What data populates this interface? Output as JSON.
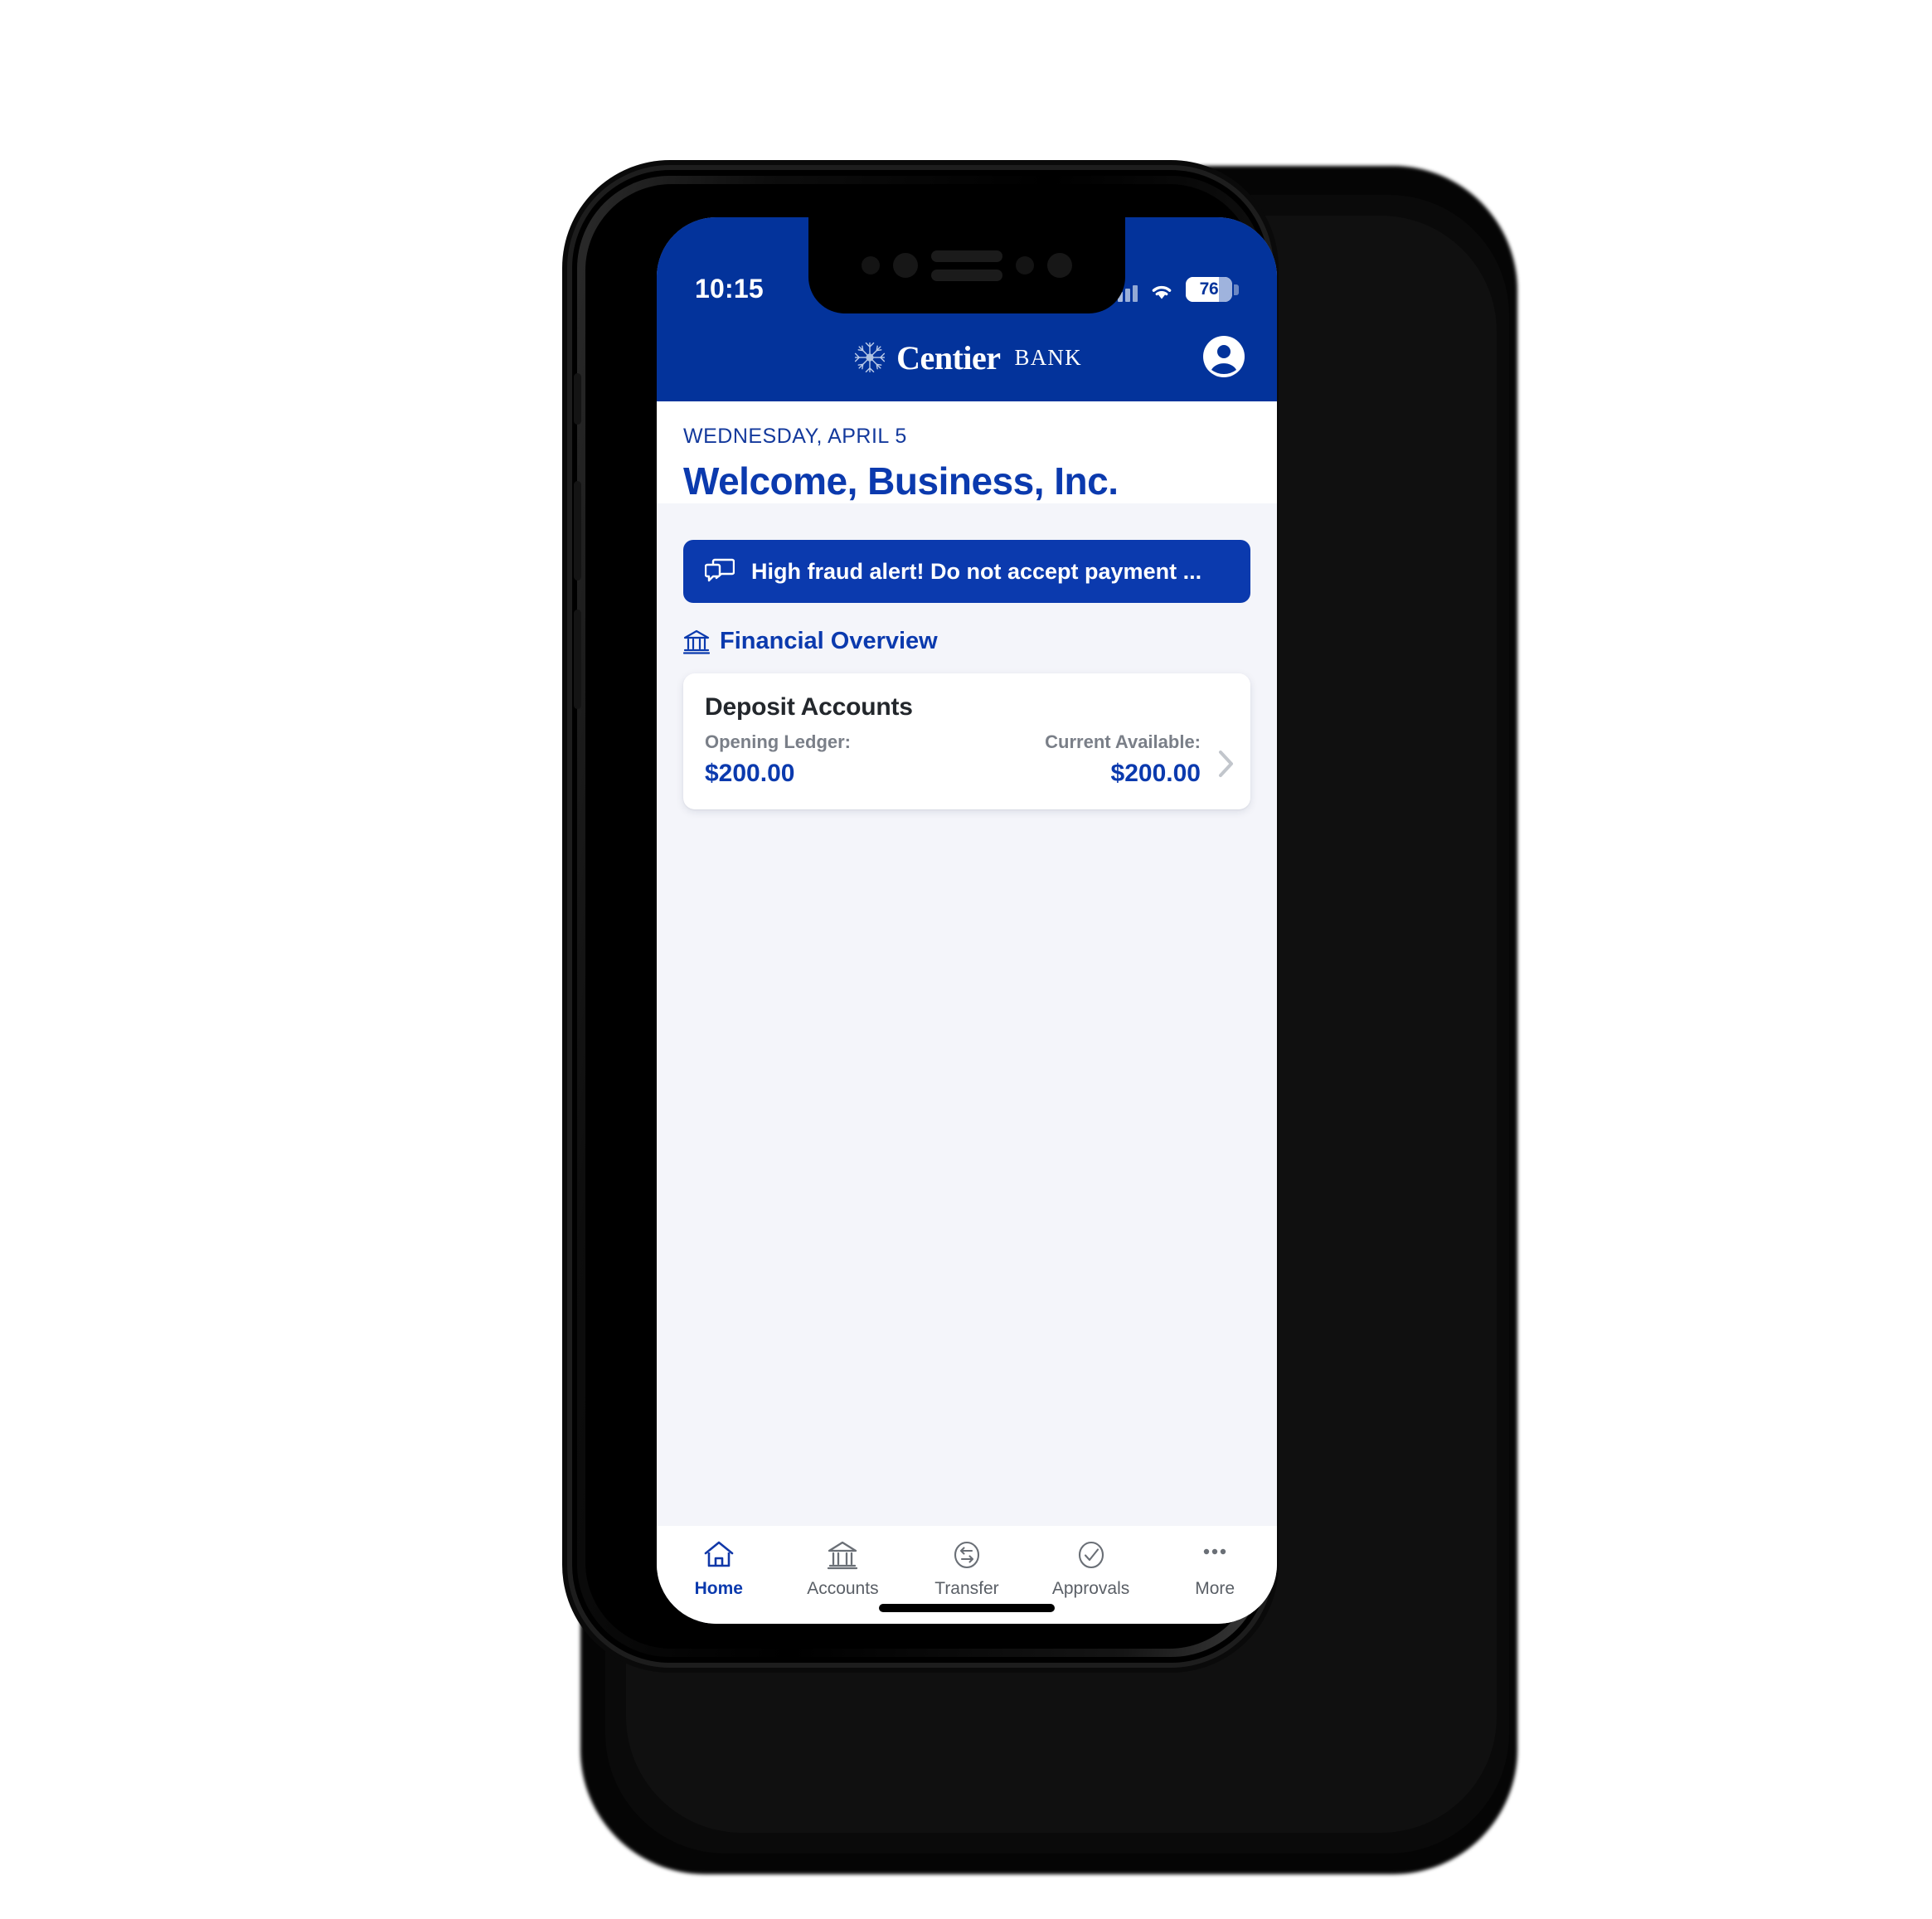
{
  "colors": {
    "brand_blue": "#03339B",
    "accent_blue": "#0B3AAE",
    "page_bg": "#F4F5FA",
    "card_bg": "#FFFFFF",
    "muted_text": "#7A7F88",
    "dark_text": "#23272C"
  },
  "status_bar": {
    "time": "10:15",
    "signal_icon": "cellular-signal-icon",
    "wifi_icon": "wifi-icon",
    "battery_level": "76",
    "battery_icon": "battery-icon"
  },
  "header": {
    "logo_mark": "snowflake-icon",
    "brand_name": "Centier",
    "brand_suffix": "BANK",
    "avatar_icon": "account-avatar-icon"
  },
  "greeting": {
    "date": "WEDNESDAY, APRIL 5",
    "welcome": "Welcome, Business, Inc."
  },
  "alert": {
    "icon": "message-bubbles-icon",
    "text": "High fraud alert! Do not accept payment ..."
  },
  "financial_overview": {
    "icon": "bank-building-icon",
    "title": "Financial Overview",
    "cards": [
      {
        "title": "Deposit Accounts",
        "left_label": "Opening Ledger:",
        "left_value": "$200.00",
        "right_label": "Current Available:",
        "right_value": "$200.00",
        "chevron_icon": "chevron-right-icon"
      }
    ]
  },
  "tabbar": {
    "items": [
      {
        "label": "Home",
        "icon": "home-icon",
        "active": true
      },
      {
        "label": "Accounts",
        "icon": "bank-icon",
        "active": false
      },
      {
        "label": "Transfer",
        "icon": "transfer-icon",
        "active": false
      },
      {
        "label": "Approvals",
        "icon": "check-circle-icon",
        "active": false
      },
      {
        "label": "More",
        "icon": "ellipsis-icon",
        "active": false
      }
    ]
  }
}
